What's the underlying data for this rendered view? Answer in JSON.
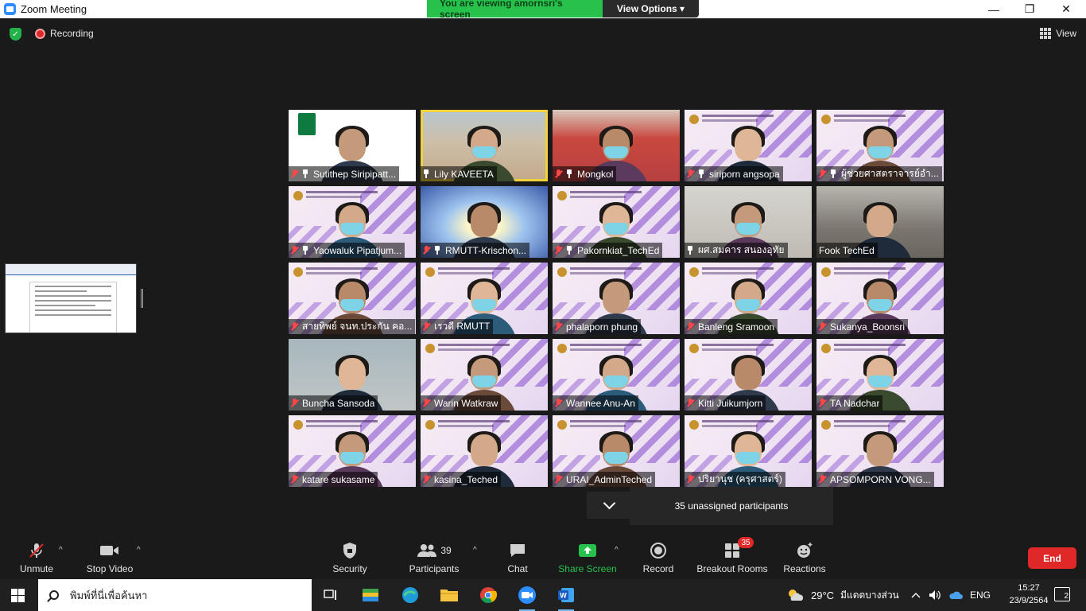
{
  "window": {
    "title": "Zoom Meeting",
    "minimize": "—",
    "maximize": "❐",
    "close": "✕"
  },
  "banner": {
    "viewing_text": "You are viewing amornsri's screen",
    "view_options": "View Options ▾"
  },
  "meeting_bar": {
    "recording": "Recording",
    "view": "View",
    "shield_glyph": "✓"
  },
  "participants": [
    {
      "name": "Sutithep Siripipatt...",
      "bg": "ku",
      "muted": true,
      "pinned": true
    },
    {
      "name": "Lily KAVEETA",
      "bg": "house",
      "muted": false,
      "pinned": true,
      "active": true
    },
    {
      "name": "Mongkol",
      "bg": "mask",
      "muted": true,
      "pinned": true
    },
    {
      "name": "siriporn angsopa",
      "bg": "purple",
      "muted": true,
      "pinned": true
    },
    {
      "name": "ผู้ช่วยศาสตราจารย์อำ...",
      "bg": "purple",
      "muted": true,
      "pinned": true
    },
    {
      "name": "Yaowaluk Pipatjum...",
      "bg": "purple",
      "muted": true,
      "pinned": true
    },
    {
      "name": "RMUTT-Krischon...",
      "bg": "sun",
      "muted": true,
      "pinned": true
    },
    {
      "name": "Pakornkiat_TechEd",
      "bg": "purple",
      "muted": true,
      "pinned": true
    },
    {
      "name": "ผศ.สมคาร  สนองอุทัย",
      "bg": "room",
      "muted": false,
      "pinned": true
    },
    {
      "name": "Fook TechEd",
      "bg": "conf",
      "muted": false,
      "pinned": false
    },
    {
      "name": "สายทิพย์ จนท.ประกัน คอ...",
      "bg": "purple",
      "muted": true,
      "pinned": false
    },
    {
      "name": "เรวดี RMUTT",
      "bg": "purple",
      "muted": true,
      "pinned": false
    },
    {
      "name": "phalaporn phung",
      "bg": "purple",
      "muted": true,
      "pinned": false
    },
    {
      "name": "Banleng Sramoon",
      "bg": "purple",
      "muted": true,
      "pinned": false
    },
    {
      "name": "Sukanya_Boonsri",
      "bg": "purple",
      "muted": true,
      "pinned": false
    },
    {
      "name": "Buncha Sansoda",
      "bg": "office",
      "muted": true,
      "pinned": false
    },
    {
      "name": "Warin Watkraw",
      "bg": "purple",
      "muted": true,
      "pinned": false
    },
    {
      "name": "Wannee Anu-An",
      "bg": "purple",
      "muted": true,
      "pinned": false
    },
    {
      "name": "Kitti Juikumjorn",
      "bg": "purple",
      "muted": true,
      "pinned": false
    },
    {
      "name": "TA Nadchar",
      "bg": "purple",
      "muted": true,
      "pinned": false
    },
    {
      "name": "katare sukasame",
      "bg": "purple",
      "muted": true,
      "pinned": false
    },
    {
      "name": "kasina_Teched",
      "bg": "purple",
      "muted": true,
      "pinned": false
    },
    {
      "name": "URAI_AdminTeched",
      "bg": "purple",
      "muted": true,
      "pinned": false
    },
    {
      "name": "ปริยานุช (ครุศาสตร์)",
      "bg": "purple",
      "muted": true,
      "pinned": false
    },
    {
      "name": "APSOMPORN VONG...",
      "bg": "purple",
      "muted": true,
      "pinned": false
    }
  ],
  "popup": {
    "unassigned": "35 unassigned participants"
  },
  "toolbar": {
    "unmute": "Unmute",
    "stop_video": "Stop Video",
    "security": "Security",
    "participants": "Participants",
    "participants_count": "39",
    "chat": "Chat",
    "share_screen": "Share Screen",
    "record": "Record",
    "breakout_rooms": "Breakout Rooms",
    "breakout_badge": "35",
    "reactions": "Reactions",
    "end": "End",
    "caret": "^"
  },
  "taskbar": {
    "search_placeholder": "พิมพ์ที่นี่เพื่อค้นหา",
    "weather_temp": "29°C",
    "weather_text": "มีแดดบางส่วน",
    "language": "ENG",
    "time": "15:27",
    "date": "23/9/2564",
    "notifications": "2",
    "word_glyph": "W"
  },
  "colors": {
    "zoom_blue": "#2d8cff",
    "banner_green": "#27c24c",
    "end_red": "#e02828",
    "active_tile": "#f2d23a"
  },
  "icons": {
    "mic": "mic-muted-icon",
    "video": "video-camera-icon",
    "security": "shield-icon",
    "participants": "people-icon",
    "chat": "chat-bubble-icon",
    "share": "share-screen-icon",
    "record": "record-icon",
    "breakout": "breakout-grid-icon",
    "reactions": "smiley-icon"
  }
}
